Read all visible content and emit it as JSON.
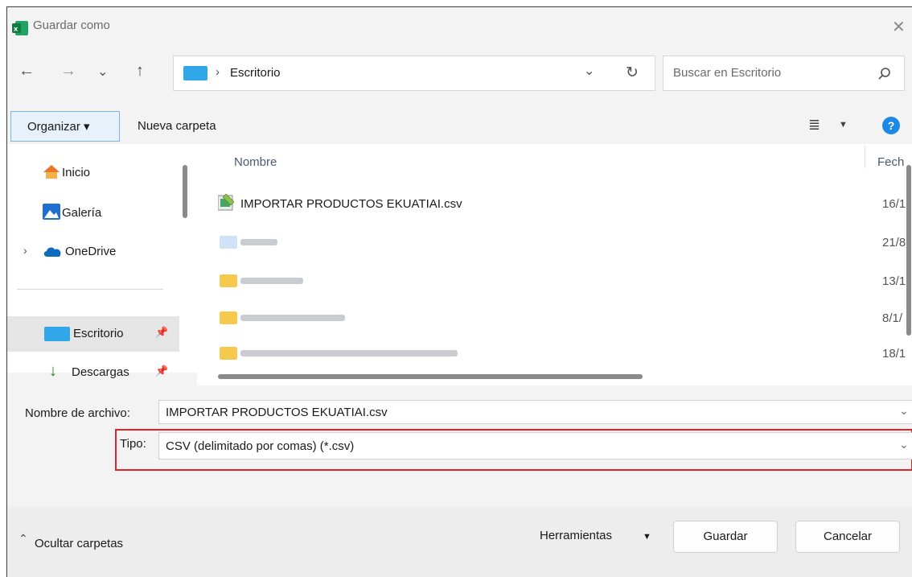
{
  "window": {
    "title": "Guardar como"
  },
  "nav": {
    "breadcrumb": "Escritorio",
    "search_placeholder": "Buscar en Escritorio"
  },
  "toolbar": {
    "organize_label": "Organizar ▾",
    "new_folder_label": "Nueva carpeta"
  },
  "sidebar": {
    "items": [
      {
        "label": "Inicio"
      },
      {
        "label": "Galería"
      },
      {
        "label": "OneDrive"
      },
      {
        "label": "Escritorio"
      },
      {
        "label": "Descargas"
      }
    ]
  },
  "files": {
    "header_name": "Nombre",
    "header_date": "Fech",
    "rows": [
      {
        "name": "IMPORTAR PRODUCTOS EKUATIAI.csv",
        "date": "16/1"
      },
      {
        "name": "",
        "date": "21/8"
      },
      {
        "name": "",
        "date": "13/1"
      },
      {
        "name": "",
        "date": "8/1/"
      },
      {
        "name": "",
        "date": "18/1"
      }
    ]
  },
  "form": {
    "filename_label": "Nombre de archivo:",
    "filename_value": "IMPORTAR PRODUCTOS EKUATIAI.csv",
    "type_label": "Tipo:",
    "type_value": "CSV (delimitado por comas) (*.csv)"
  },
  "footer": {
    "hide_folders": "Ocultar carpetas",
    "tools": "Herramientas",
    "save": "Guardar",
    "cancel": "Cancelar"
  },
  "colors": {
    "highlight_box": "#e0242c",
    "accent": "#0078d4"
  }
}
